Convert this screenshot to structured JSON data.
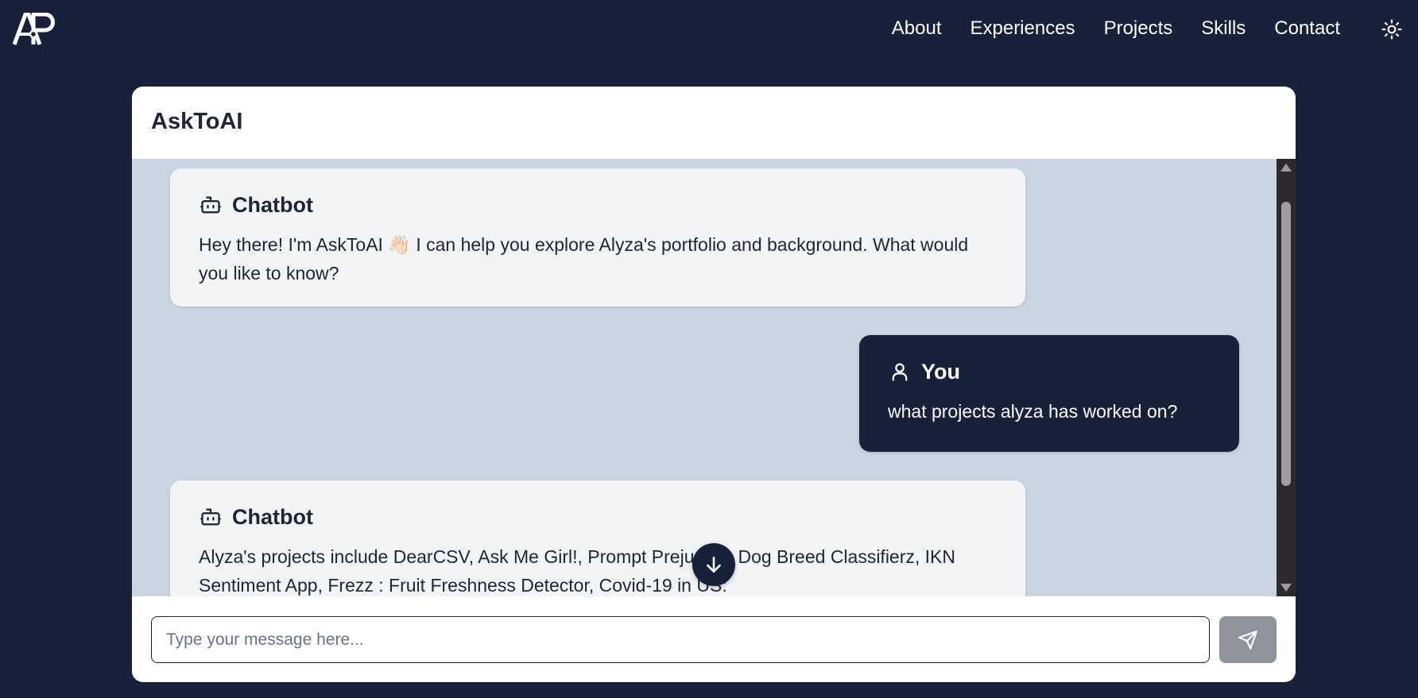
{
  "nav": {
    "logo_text": "AP",
    "links": [
      "About",
      "Experiences",
      "Projects",
      "Skills",
      "Contact"
    ],
    "theme_toggle_icon": "sun-icon"
  },
  "chat": {
    "title": "AskToAI",
    "messages": [
      {
        "role": "bot",
        "author": "Chatbot",
        "icon": "bot-icon",
        "text": "Hey there! I'm AskToAI 👋🏻 I can help you explore Alyza's portfolio and background. What would you like to know?"
      },
      {
        "role": "user",
        "author": "You",
        "icon": "user-icon",
        "text": "what projects alyza has worked on?"
      },
      {
        "role": "bot",
        "author": "Chatbot",
        "icon": "bot-icon",
        "text": "Alyza's projects include DearCSV, Ask Me Girl!, Prompt Prejudice, Dog Breed Classifierz, IKN Sentiment App, Frezz : Fruit Freshness Detector, Covid-19 in US:"
      }
    ],
    "input_placeholder": "Type your message here...",
    "input_value": "",
    "send_icon": "send-icon",
    "scroll_down_icon": "arrow-down-icon"
  },
  "colors": {
    "page_background": "#18213a",
    "chat_area_background": "#cbd5e1",
    "bot_bubble": "#f3f4f6",
    "user_bubble": "#18213a",
    "send_button": "#8f949c"
  }
}
